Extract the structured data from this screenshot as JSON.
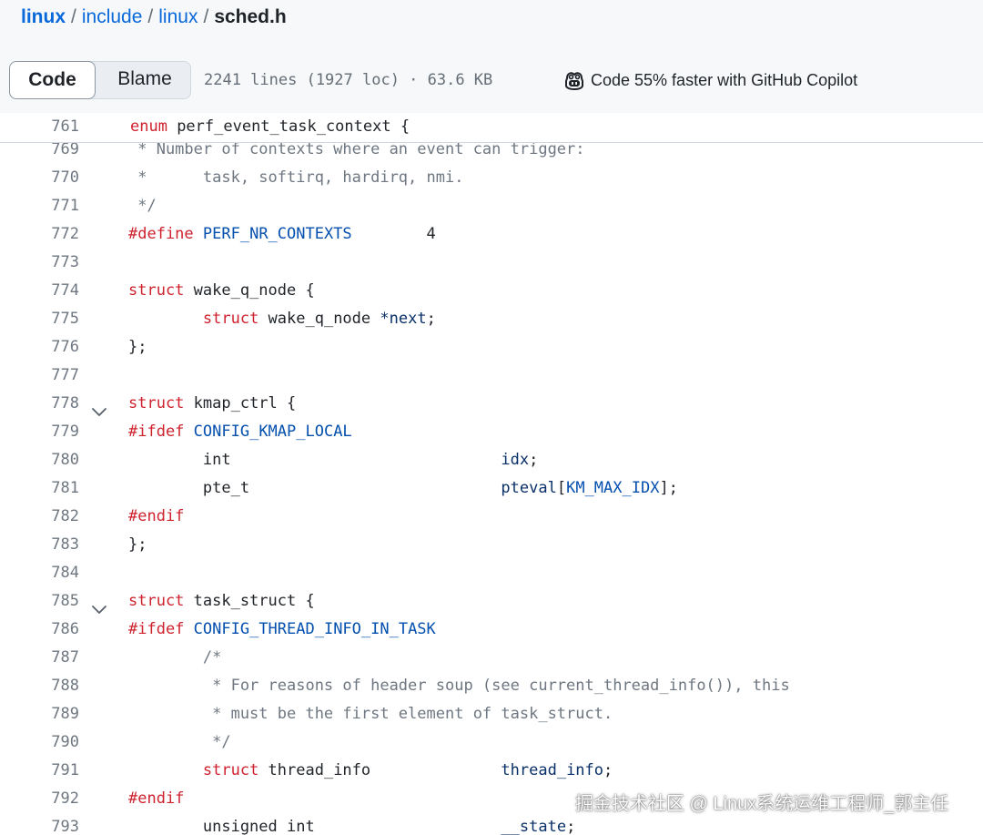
{
  "breadcrumb": {
    "repo": "linux",
    "sep1": "/",
    "dir1": "include",
    "sep2": "/",
    "dir2": "linux",
    "sep3": "/",
    "file": "sched.h"
  },
  "toolbar": {
    "code_label": "Code",
    "blame_label": "Blame",
    "file_info": "2241 lines (1927 loc) · 63.6 KB",
    "copilot_label": "Code 55% faster with GitHub Copilot",
    "copilot_icon": "copilot-icon"
  },
  "sticky_line": {
    "number": "761",
    "code": "enum perf_event_task_context {"
  },
  "lines": [
    {
      "number": "769",
      "code": " * Number of contexts where an event can trigger:"
    },
    {
      "number": "770",
      "code": " *      task, softirq, hardirq, nmi."
    },
    {
      "number": "771",
      "code": " */"
    },
    {
      "number": "772",
      "code": "#define PERF_NR_CONTEXTS        4"
    },
    {
      "number": "773",
      "code": ""
    },
    {
      "number": "774",
      "code": "struct wake_q_node {"
    },
    {
      "number": "775",
      "code": "        struct wake_q_node *next;"
    },
    {
      "number": "776",
      "code": "};"
    },
    {
      "number": "777",
      "code": ""
    },
    {
      "number": "778",
      "code": "struct kmap_ctrl {",
      "foldable": true
    },
    {
      "number": "779",
      "code": "#ifdef CONFIG_KMAP_LOCAL"
    },
    {
      "number": "780",
      "code": "        int                             idx;"
    },
    {
      "number": "781",
      "code": "        pte_t                           pteval[KM_MAX_IDX];"
    },
    {
      "number": "782",
      "code": "#endif"
    },
    {
      "number": "783",
      "code": "};"
    },
    {
      "number": "784",
      "code": ""
    },
    {
      "number": "785",
      "code": "struct task_struct {",
      "foldable": true
    },
    {
      "number": "786",
      "code": "#ifdef CONFIG_THREAD_INFO_IN_TASK"
    },
    {
      "number": "787",
      "code": "        /*"
    },
    {
      "number": "788",
      "code": "         * For reasons of header soup (see current_thread_info()), this"
    },
    {
      "number": "789",
      "code": "         * must be the first element of task_struct."
    },
    {
      "number": "790",
      "code": "         */"
    },
    {
      "number": "791",
      "code": "        struct thread_info              thread_info;"
    },
    {
      "number": "792",
      "code": "#endif"
    },
    {
      "number": "793",
      "code": "        unsigned int                    __state;"
    }
  ],
  "watermark": "掘金技术社区 @ Linux系统运维工程师_郭主任",
  "colors": {
    "keyword": "#cf222e",
    "comment": "#6e7781",
    "identifier": "#0a3069",
    "macro": "#0550ae",
    "link": "#0969da"
  }
}
